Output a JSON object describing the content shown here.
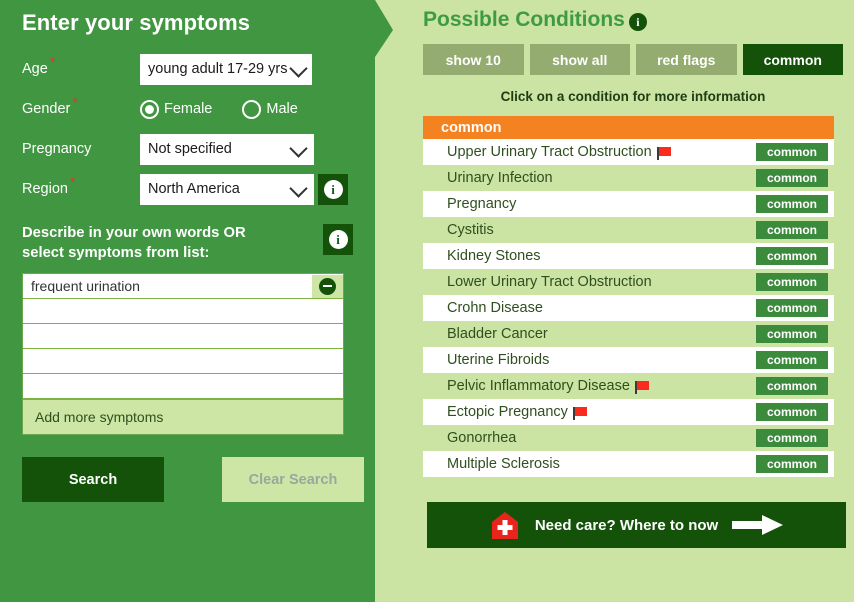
{
  "left_panel": {
    "title": "Enter your symptoms",
    "fields": {
      "age": {
        "label": "Age",
        "value": "young adult 17-29 yrs",
        "required_mark": "*"
      },
      "gender": {
        "label": "Gender",
        "required_mark": "*",
        "options": [
          {
            "label": "Female",
            "selected": true
          },
          {
            "label": "Male",
            "selected": false
          }
        ]
      },
      "pregnancy": {
        "label": "Pregnancy",
        "value": "Not specified"
      },
      "region": {
        "label": "Region",
        "value": "North America",
        "required_mark": "*",
        "info_icon": "info-icon"
      }
    },
    "describe": {
      "text": "Describe in your own words OR select symptoms from list:",
      "info_icon": "info-icon"
    },
    "symptoms": {
      "rows": [
        {
          "value": "frequent urination",
          "has_remove": true
        },
        {
          "value": "",
          "has_remove": false
        },
        {
          "value": "",
          "has_remove": false
        },
        {
          "value": "",
          "has_remove": false
        },
        {
          "value": "",
          "has_remove": false
        }
      ],
      "add_more_label": "Add more symptoms",
      "remove_icon": "minus-circle-icon"
    },
    "buttons": {
      "search": "Search",
      "clear": "Clear Search"
    }
  },
  "right_panel": {
    "title": "Possible Conditions",
    "title_info_icon": "info-icon",
    "tabs": [
      {
        "label": "show 10",
        "active": false
      },
      {
        "label": "show all",
        "active": false
      },
      {
        "label": "red flags",
        "active": false
      },
      {
        "label": "common",
        "active": true
      }
    ],
    "hint": "Click on a condition for more information",
    "section_header": "common",
    "conditions": [
      {
        "name": "Upper Urinary Tract Obstruction",
        "badge": "common",
        "red_flag": true
      },
      {
        "name": "Urinary Infection",
        "badge": "common",
        "red_flag": false
      },
      {
        "name": "Pregnancy",
        "badge": "common",
        "red_flag": false
      },
      {
        "name": "Cystitis",
        "badge": "common",
        "red_flag": false
      },
      {
        "name": "Kidney Stones",
        "badge": "common",
        "red_flag": false
      },
      {
        "name": "Lower Urinary Tract Obstruction",
        "badge": "common",
        "red_flag": false
      },
      {
        "name": "Crohn Disease",
        "badge": "common",
        "red_flag": false
      },
      {
        "name": "Bladder Cancer",
        "badge": "common",
        "red_flag": false
      },
      {
        "name": "Uterine Fibroids",
        "badge": "common",
        "red_flag": false
      },
      {
        "name": "Pelvic Inflammatory Disease",
        "badge": "common",
        "red_flag": true
      },
      {
        "name": "Ectopic Pregnancy",
        "badge": "common",
        "red_flag": true
      },
      {
        "name": "Gonorrhea",
        "badge": "common",
        "red_flag": false
      },
      {
        "name": "Multiple Sclerosis",
        "badge": "common",
        "red_flag": false
      }
    ],
    "need_care": {
      "label": "Need care?  Where to now",
      "icon": "hospital-icon",
      "arrow_icon": "arrow-right-icon"
    }
  },
  "colors": {
    "panel_green": "#419641",
    "page_green": "#cbe3a3",
    "dark_green": "#14520a",
    "accent_orange": "#f58220",
    "badge_green": "#3c8a3c",
    "tab_inactive": "#94ac70",
    "red_flag": "#fa2a1e",
    "required_star": "#ff2a2a",
    "title_green": "#3f9b42"
  }
}
